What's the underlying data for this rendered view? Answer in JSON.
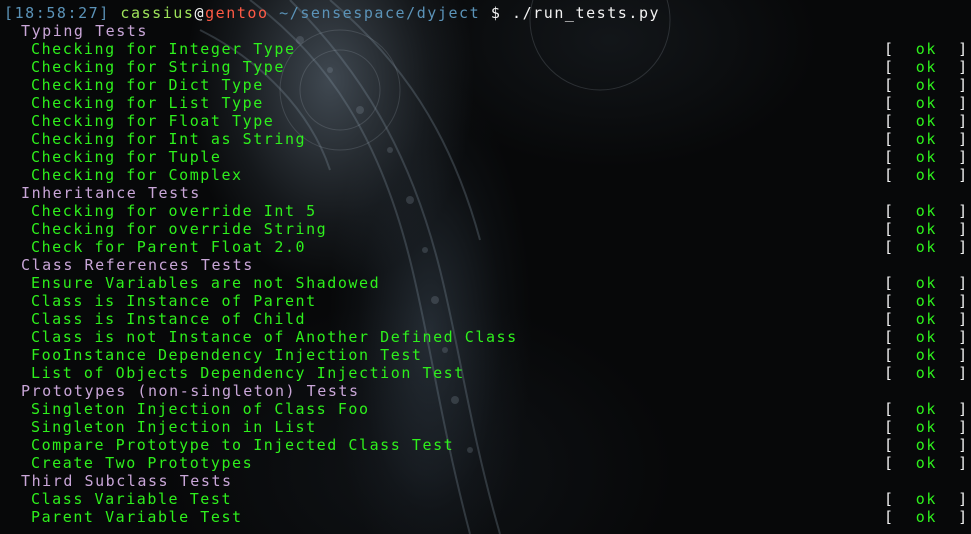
{
  "prompt": {
    "time": "[18:58:27]",
    "user": "cassius",
    "at": "@",
    "host": "gentoo",
    "path": "~/sensespace/dyject",
    "dollar": "$",
    "command": "./run_tests.py"
  },
  "status": {
    "open": "[",
    "ok": "ok",
    "close": "]"
  },
  "sections": [
    {
      "title": "Typing Tests",
      "tests": [
        "Checking for Integer Type",
        "Checking for String Type",
        "Checking for Dict Type",
        "Checking for List Type",
        "Checking for Float Type",
        "Checking for Int as String",
        "Checking for Tuple",
        "Checking for Complex"
      ]
    },
    {
      "title": "Inheritance Tests",
      "tests": [
        "Checking for override Int 5",
        "Checking for override String",
        "Check for Parent Float 2.0"
      ]
    },
    {
      "title": "Class References Tests",
      "tests": [
        "Ensure Variables are not Shadowed",
        "Class is Instance of Parent",
        "Class is Instance of Child",
        "Class is not Instance of Another Defined Class",
        "FooInstance Dependency Injection Test",
        "List of Objects Dependency Injection Test"
      ]
    },
    {
      "title": "Prototypes (non-singleton) Tests",
      "tests": [
        "Singleton Injection of Class Foo",
        "Singleton Injection in List",
        "Compare Prototype to Injected Class Test",
        "Create Two Prototypes"
      ]
    },
    {
      "title": "Third Subclass Tests",
      "tests": [
        "Class Variable Test",
        "Parent Variable Test"
      ]
    }
  ]
}
